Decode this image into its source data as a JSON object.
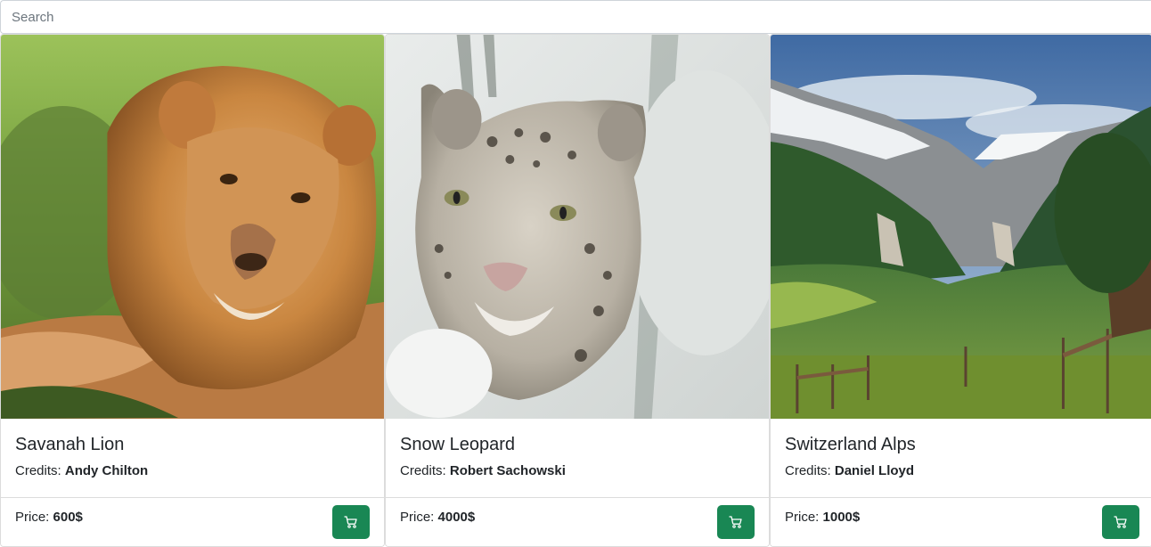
{
  "search": {
    "placeholder": "Search",
    "value": ""
  },
  "products": [
    {
      "title": "Savanah Lion",
      "credits_label": "Credits:",
      "author": "Andy Chilton",
      "price_label": "Price:",
      "price": "600$",
      "image": "lion-photo"
    },
    {
      "title": "Snow Leopard",
      "credits_label": "Credits:",
      "author": "Robert Sachowski",
      "price_label": "Price:",
      "price": "4000$",
      "image": "snow-leopard-photo"
    },
    {
      "title": "Switzerland Alps",
      "credits_label": "Credits:",
      "author": "Daniel Lloyd",
      "price_label": "Price:",
      "price": "1000$",
      "image": "alps-landscape-photo"
    }
  ],
  "colors": {
    "cart_button": "#198754",
    "border": "#dcdcdc",
    "text": "#212529"
  },
  "icons": {
    "cart": "cart-icon"
  }
}
